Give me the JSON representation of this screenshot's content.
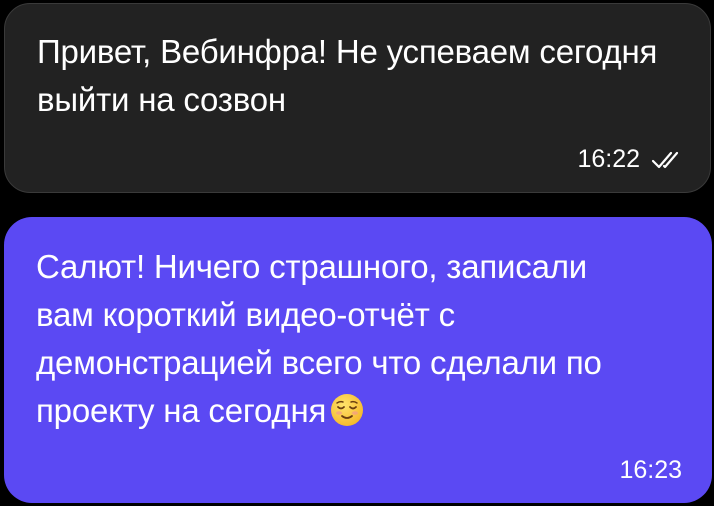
{
  "messages": [
    {
      "direction": "incoming",
      "text": "Привет, Вебинфра! Не успеваем сегодня\nвыйти на созвон",
      "time": "16:22",
      "status_icon": "double-check-icon"
    },
    {
      "direction": "outgoing",
      "text": "Салют! Ничего страшного, записали\nвам короткий видео-отчёт с\nдемонстрацией всего что сделали по\nпроекту на сегодня",
      "emoji": "relieved-face-emoji",
      "time": "16:23"
    }
  ],
  "colors": {
    "background": "#000000",
    "incoming_bubble": "#222222",
    "outgoing_bubble": "#5b49f3",
    "text": "#ffffff"
  }
}
